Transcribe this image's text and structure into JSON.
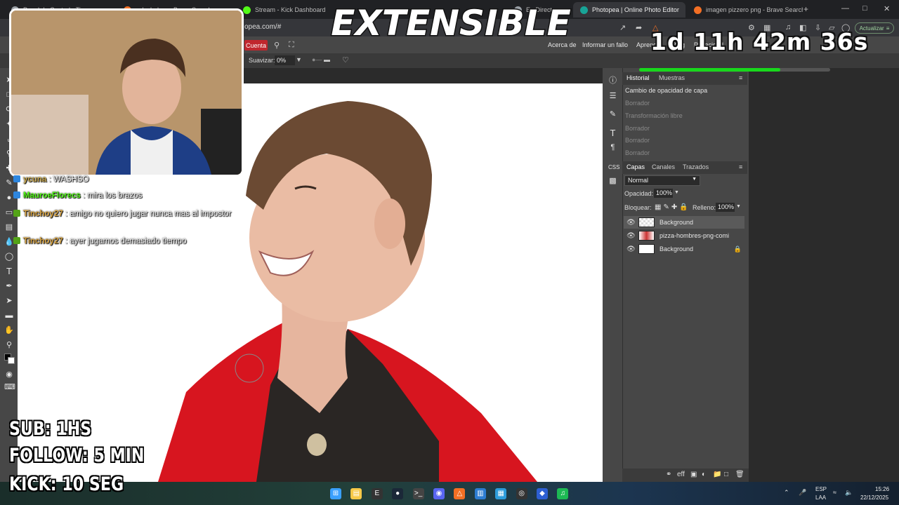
{
  "browser": {
    "tabs": [
      {
        "title": "Panel de Control - Timer",
        "active": false,
        "favicon_color": "#9aa0a6"
      },
      {
        "title": "calculadora - Brave Search",
        "active": false,
        "favicon_color": "#f36f24"
      },
      {
        "title": "Stream - Kick Dashboard",
        "active": false,
        "favicon_color": "#53fc18"
      },
      {
        "title": "En Directo",
        "active": false,
        "favicon_color": "#9aa0a6"
      },
      {
        "title": "Photopea | Online Photo Editor",
        "active": true,
        "favicon_color": "#18a497"
      },
      {
        "title": "imagen pizzero png - Brave Search",
        "active": false,
        "favicon_color": "#f36f24"
      }
    ],
    "url": "opea.com/#",
    "update_label": "Actualizar",
    "update_badge": "1"
  },
  "photopea": {
    "account_label": "Cuenta",
    "menu_links": [
      "Acerca de",
      "Informar un fallo",
      "Aprender",
      "Blog",
      "Privacidad"
    ],
    "options": {
      "smooth_label": "Suavizar:",
      "smooth_value": "0%"
    },
    "history": {
      "tabs": [
        "Historial",
        "Muestras"
      ],
      "items": [
        "Cambio de opacidad de capa",
        "Borrador",
        "Transformación libre",
        "Borrador",
        "Borrador",
        "Borrador"
      ]
    },
    "layers": {
      "tabs": [
        "Capas",
        "Canales",
        "Trazados"
      ],
      "blend_mode": "Normal",
      "opacity_label": "Opacidad:",
      "opacity_value": "100%",
      "lock_label": "Bloquear:",
      "fill_label": "Relleno:",
      "fill_value": "100%",
      "items": [
        {
          "name": "Background",
          "selected": true,
          "locked": false
        },
        {
          "name": "pizza-hombres-png-comi",
          "selected": false,
          "locked": false
        },
        {
          "name": "Background",
          "selected": false,
          "locked": true
        }
      ]
    },
    "side_labels": [
      "CSS"
    ]
  },
  "overlay": {
    "title_banner": "EXTENSIBLE",
    "countdown": "1d 11h 42m 36s",
    "progress_fraction": 0.74,
    "progress_color": "#18d81c",
    "chat": [
      {
        "user": "ycuna",
        "message": "WASHSO",
        "user_color": "#c9a84c"
      },
      {
        "user": "MauroeFlorecs",
        "message": "mira los brazos",
        "user_color": "#53fc18"
      },
      {
        "user": "Tinchoy27",
        "message": "amigo no quiero jugar nunca mas al impostor",
        "user_color": "#d9a441"
      },
      {
        "user": "Tinchoy27",
        "message": "ayer jugamos demasiado tiempo",
        "user_color": "#d9a441"
      }
    ],
    "commands": [
      "SUB: 1HS",
      "FOLLOW: 5 MIN",
      "KICK: 10 SEG"
    ]
  },
  "taskbar": {
    "apps": [
      "start-icon",
      "file-explorer-icon",
      "epic-games-icon",
      "steam-icon",
      "terminal-icon",
      "discord-icon",
      "brave-icon",
      "notepad-icon",
      "notes-icon",
      "obs-icon",
      "app-icon",
      "spotify-icon"
    ],
    "language": "ESP",
    "layout": "LAA",
    "time": "15:26",
    "date": "22/12/2025"
  }
}
